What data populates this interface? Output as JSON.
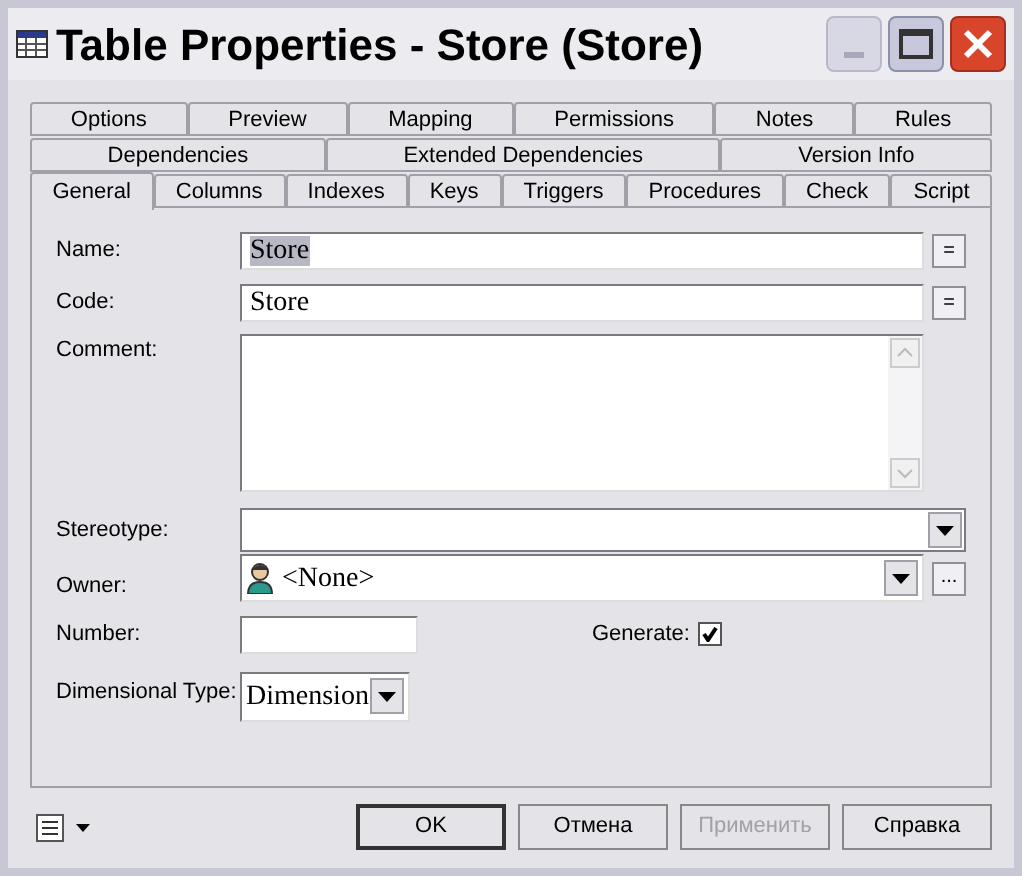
{
  "window": {
    "title": "Table Properties - Store (Store)"
  },
  "tab_rows": [
    [
      {
        "label": "Options",
        "selected": false
      },
      {
        "label": "Preview",
        "selected": false
      },
      {
        "label": "Mapping",
        "selected": false
      },
      {
        "label": "Permissions",
        "selected": false
      },
      {
        "label": "Notes",
        "selected": false
      },
      {
        "label": "Rules",
        "selected": false
      }
    ],
    [
      {
        "label": "Dependencies",
        "selected": false
      },
      {
        "label": "Extended Dependencies",
        "selected": false
      },
      {
        "label": "Version Info",
        "selected": false
      }
    ],
    [
      {
        "label": "General",
        "selected": true
      },
      {
        "label": "Columns",
        "selected": false
      },
      {
        "label": "Indexes",
        "selected": false
      },
      {
        "label": "Keys",
        "selected": false
      },
      {
        "label": "Triggers",
        "selected": false
      },
      {
        "label": "Procedures",
        "selected": false
      },
      {
        "label": "Check",
        "selected": false
      },
      {
        "label": "Script",
        "selected": false
      }
    ]
  ],
  "form": {
    "name": {
      "label": "Name:",
      "value": "Store",
      "highlighted": true,
      "button": "="
    },
    "code": {
      "label": "Code:",
      "value": "Store",
      "button": "="
    },
    "comment": {
      "label": "Comment:"
    },
    "stereotype": {
      "label": "Stereotype:"
    },
    "owner": {
      "label": "Owner:",
      "value": "<None>",
      "button": "..."
    },
    "number": {
      "label": "Number:"
    },
    "generate": {
      "label": "Generate:",
      "checked": true
    },
    "dimensional_type": {
      "label": "Dimensional Type:",
      "value": "Dimension"
    }
  },
  "buttons": [
    {
      "label": "OK",
      "disabled": false,
      "default": true
    },
    {
      "label": "Отмена",
      "disabled": false,
      "default": false
    },
    {
      "label": "Применить",
      "disabled": true,
      "default": false
    },
    {
      "label": "Справка",
      "disabled": false,
      "default": false
    }
  ]
}
